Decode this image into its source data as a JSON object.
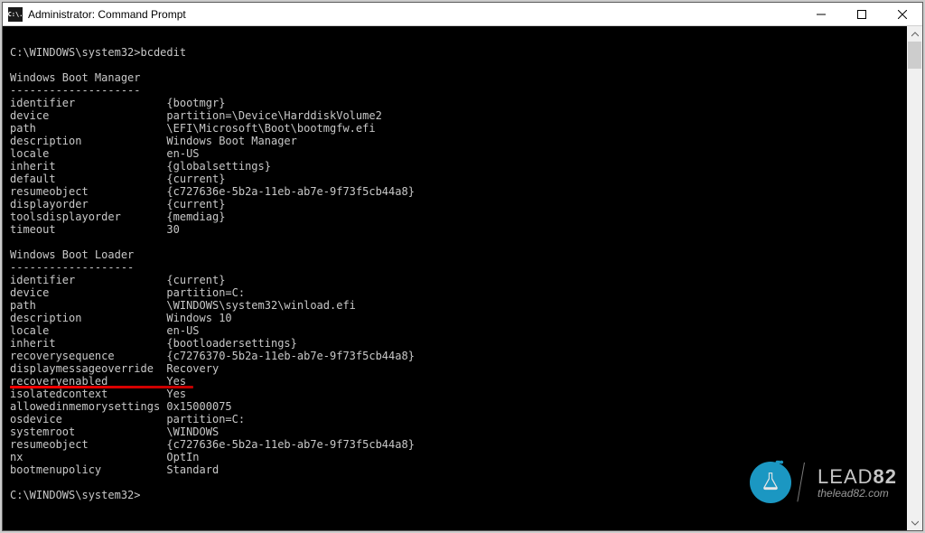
{
  "window": {
    "title": "Administrator: Command Prompt",
    "icon_text": "C:\\."
  },
  "prompt": {
    "path": "C:\\WINDOWS\\system32>",
    "command": "bcdedit"
  },
  "sections": [
    {
      "header": "Windows Boot Manager",
      "rows": [
        {
          "k": "identifier",
          "v": "{bootmgr}"
        },
        {
          "k": "device",
          "v": "partition=\\Device\\HarddiskVolume2"
        },
        {
          "k": "path",
          "v": "\\EFI\\Microsoft\\Boot\\bootmgfw.efi"
        },
        {
          "k": "description",
          "v": "Windows Boot Manager"
        },
        {
          "k": "locale",
          "v": "en-US"
        },
        {
          "k": "inherit",
          "v": "{globalsettings}"
        },
        {
          "k": "default",
          "v": "{current}"
        },
        {
          "k": "resumeobject",
          "v": "{c727636e-5b2a-11eb-ab7e-9f73f5cb44a8}"
        },
        {
          "k": "displayorder",
          "v": "{current}"
        },
        {
          "k": "toolsdisplayorder",
          "v": "{memdiag}"
        },
        {
          "k": "timeout",
          "v": "30"
        }
      ]
    },
    {
      "header": "Windows Boot Loader",
      "rows": [
        {
          "k": "identifier",
          "v": "{current}"
        },
        {
          "k": "device",
          "v": "partition=C:"
        },
        {
          "k": "path",
          "v": "\\WINDOWS\\system32\\winload.efi"
        },
        {
          "k": "description",
          "v": "Windows 10"
        },
        {
          "k": "locale",
          "v": "en-US"
        },
        {
          "k": "inherit",
          "v": "{bootloadersettings}"
        },
        {
          "k": "recoverysequence",
          "v": "{c7276370-5b2a-11eb-ab7e-9f73f5cb44a8}"
        },
        {
          "k": "displaymessageoverride",
          "v": "Recovery"
        },
        {
          "k": "recoveryenabled",
          "v": "Yes",
          "underline": true
        },
        {
          "k": "isolatedcontext",
          "v": "Yes"
        },
        {
          "k": "allowedinmemorysettings",
          "v": "0x15000075"
        },
        {
          "k": "osdevice",
          "v": "partition=C:"
        },
        {
          "k": "systemroot",
          "v": "\\WINDOWS"
        },
        {
          "k": "resumeobject",
          "v": "{c727636e-5b2a-11eb-ab7e-9f73f5cb44a8}"
        },
        {
          "k": "nx",
          "v": "OptIn"
        },
        {
          "k": "bootmenupolicy",
          "v": "Standard"
        }
      ]
    }
  ],
  "trailing_prompt": "C:\\WINDOWS\\system32>",
  "watermark": {
    "brand_a": "LEAD",
    "brand_b": "82",
    "url": "thelead82.com"
  }
}
